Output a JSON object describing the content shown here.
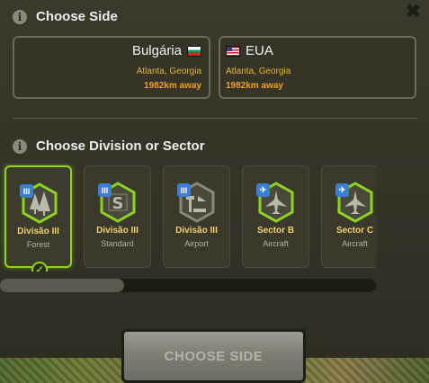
{
  "dialog": {
    "close_label": "✖",
    "side_section_title": "Choose Side",
    "division_section_title": "Choose Division or Sector",
    "info_glyph": "i",
    "choose_button_label": "CHOOSE SIDE"
  },
  "sides": [
    {
      "name": "Bulgária",
      "flag": "flag-bulgaria-icon",
      "location": "Atlanta, Georgia",
      "distance": "1982km away"
    },
    {
      "name": "EUA",
      "flag": "flag-usa-icon",
      "location": "Atlanta, Georgia",
      "distance": "1982km away"
    }
  ],
  "tiles": [
    {
      "badge": "III",
      "badge_color": "#3a7fd0",
      "title": "Divisão III",
      "subtitle": "Forest",
      "icon": "forest-icon",
      "selected": true
    },
    {
      "badge": "III",
      "badge_color": "#3a7fd0",
      "title": "Divisão III",
      "subtitle": "Standard",
      "icon": "standard-s-icon",
      "selected": false
    },
    {
      "badge": "III",
      "badge_color": "#3a7fd0",
      "title": "Divisão III",
      "subtitle": "Airport",
      "icon": "airport-icon",
      "selected": false
    },
    {
      "badge": "✈",
      "badge_color": "#3a7fd0",
      "title": "Sector B",
      "subtitle": "Aircraft",
      "icon": "aircraft-icon",
      "selected": false
    },
    {
      "badge": "✈",
      "badge_color": "#3a7fd0",
      "title": "Sector C",
      "subtitle": "Aircraft",
      "icon": "aircraft-icon",
      "selected": false
    }
  ],
  "scroll": {
    "position": 0.0,
    "visible_fraction": 0.33
  },
  "colors": {
    "accent_green": "#8fd322",
    "highlight_orange": "#f0a020",
    "tile_title": "#f0d070"
  }
}
